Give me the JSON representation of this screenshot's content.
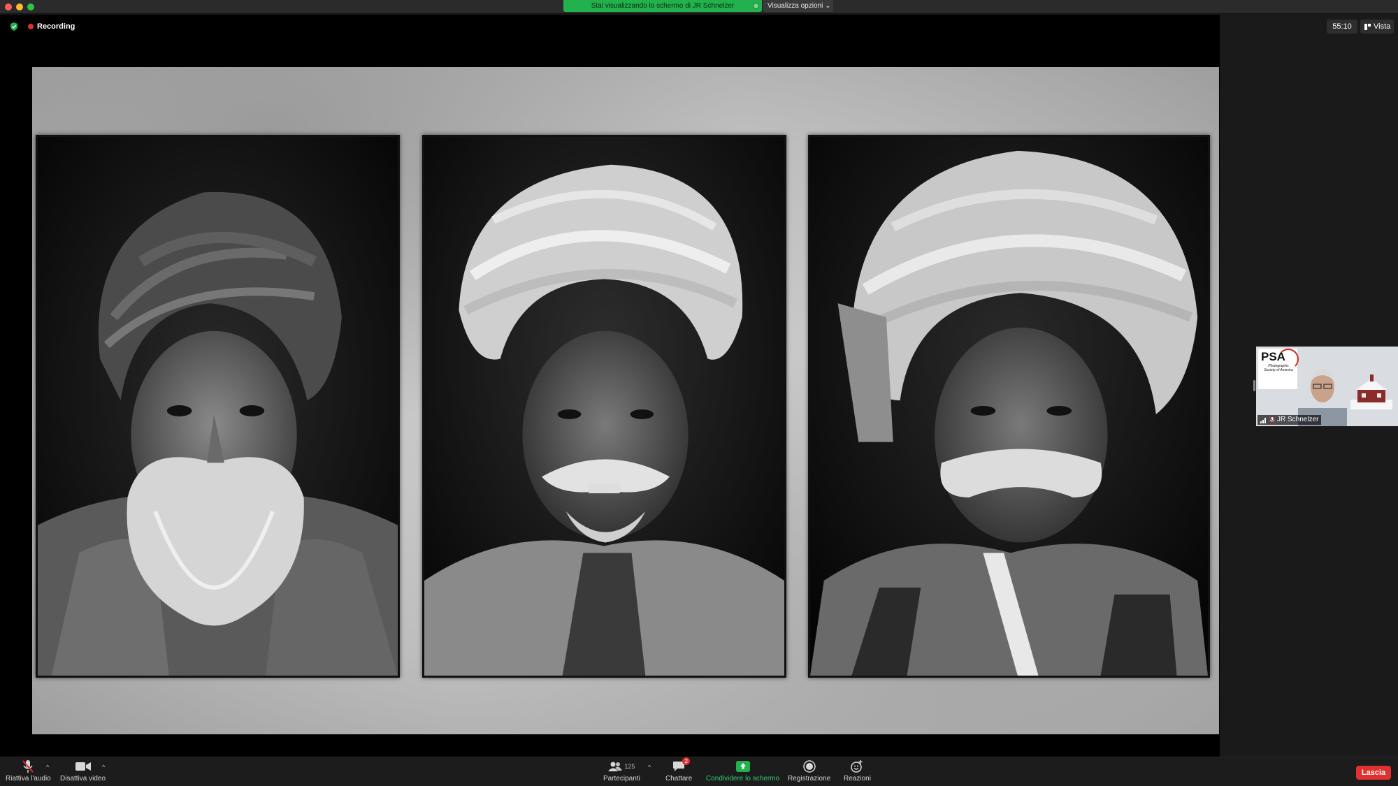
{
  "titlebar": {
    "share_banner": "Stai visualizzando lo schermo di JR Schnelzer",
    "view_options": "Visualizza opzioni"
  },
  "overlay": {
    "recording": "Recording",
    "timer": "55:10",
    "view_button": "Vista"
  },
  "self_video": {
    "name": "JR Schnelzer",
    "logo_text": "PSA",
    "logo_subtext": "Photographic Society of America"
  },
  "toolbar": {
    "audio_label": "Riattiva l'audio",
    "video_label": "Disattiva video",
    "participants_label": "Partecipanti",
    "participants_count": "125",
    "chat_label": "Chattare",
    "chat_badge": "2",
    "share_label": "Condividere lo schermo",
    "record_label": "Registrazione",
    "reactions_label": "Reazioni",
    "leave_label": "Lascia"
  },
  "colors": {
    "share_green": "#22b14c",
    "leave_red": "#e0312f",
    "recording_red": "#e0312f"
  }
}
